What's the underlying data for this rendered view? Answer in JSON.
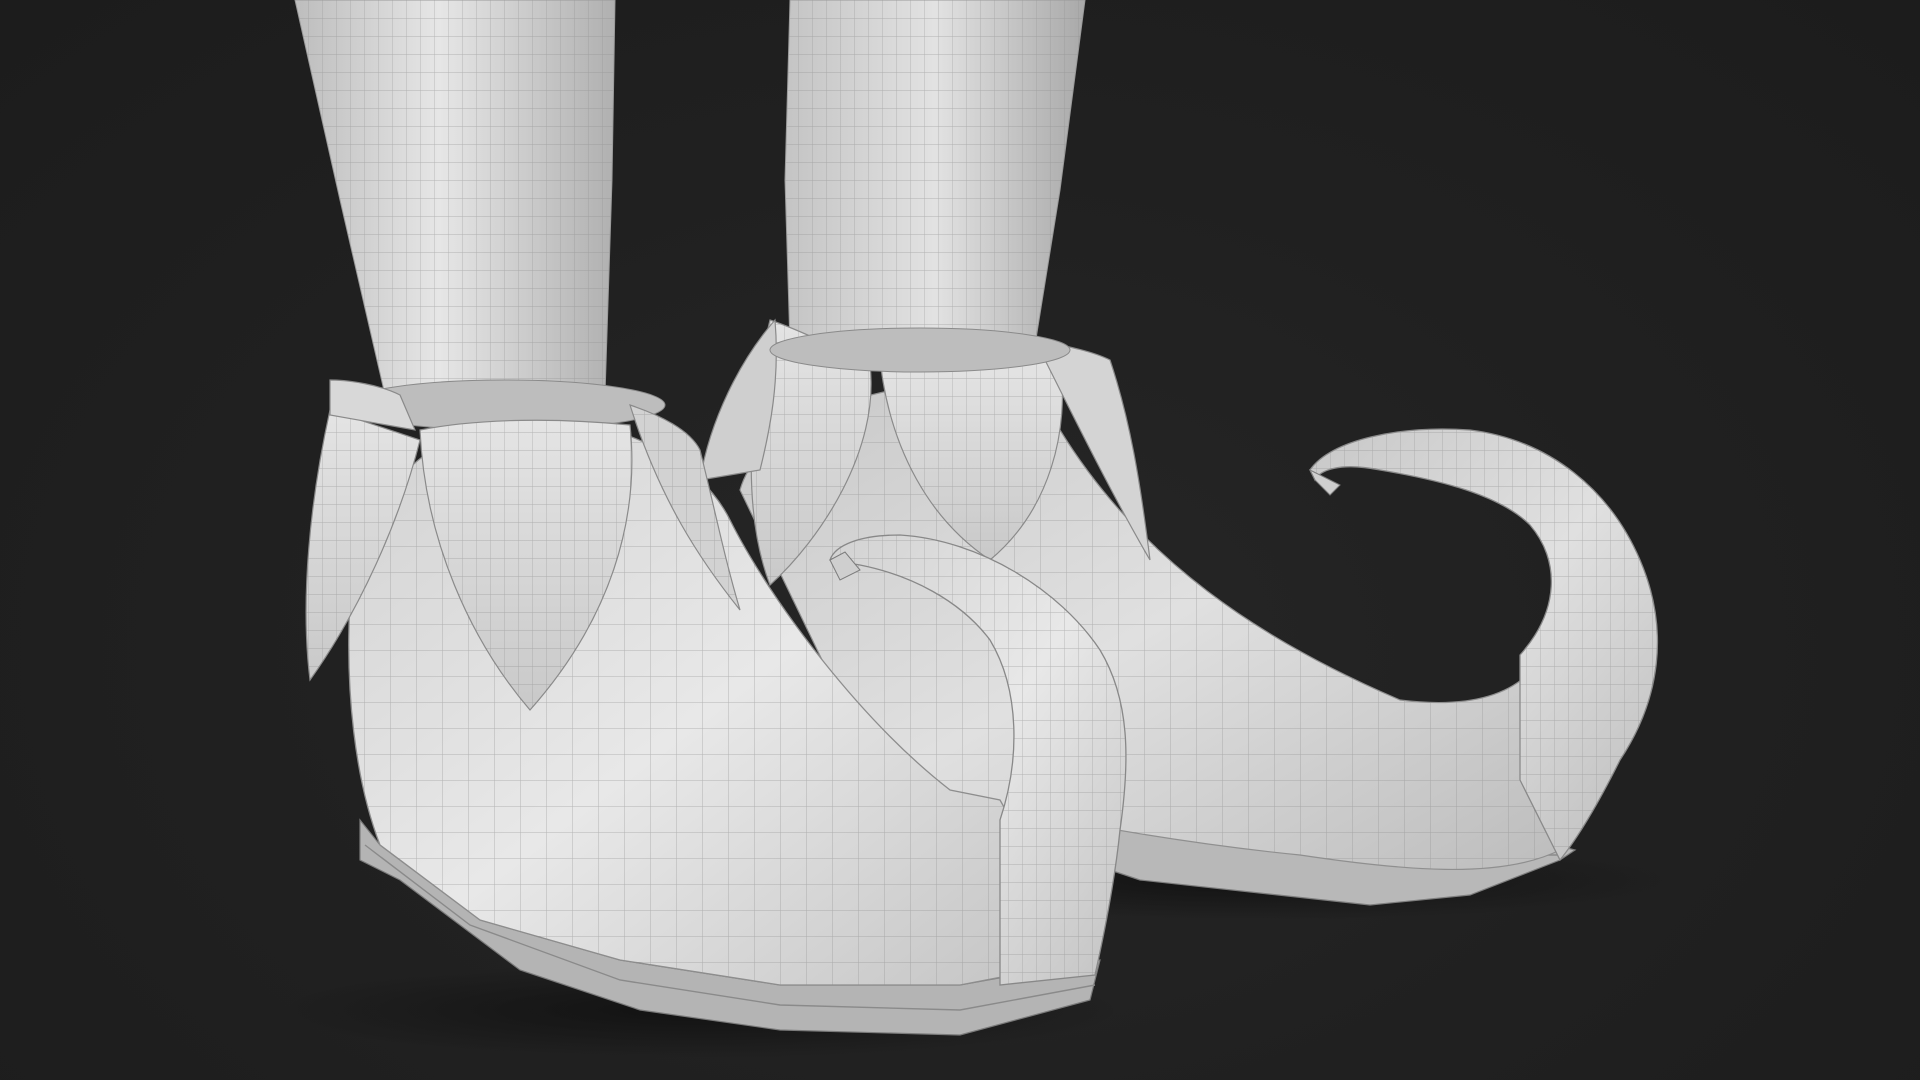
{
  "scene": {
    "subject": "elf-shoes-wireframe-render",
    "background_color": "#202020",
    "model_color": "#d9d9d9",
    "wire_color": "#8a8a8a",
    "shadow_color": "#141414"
  }
}
